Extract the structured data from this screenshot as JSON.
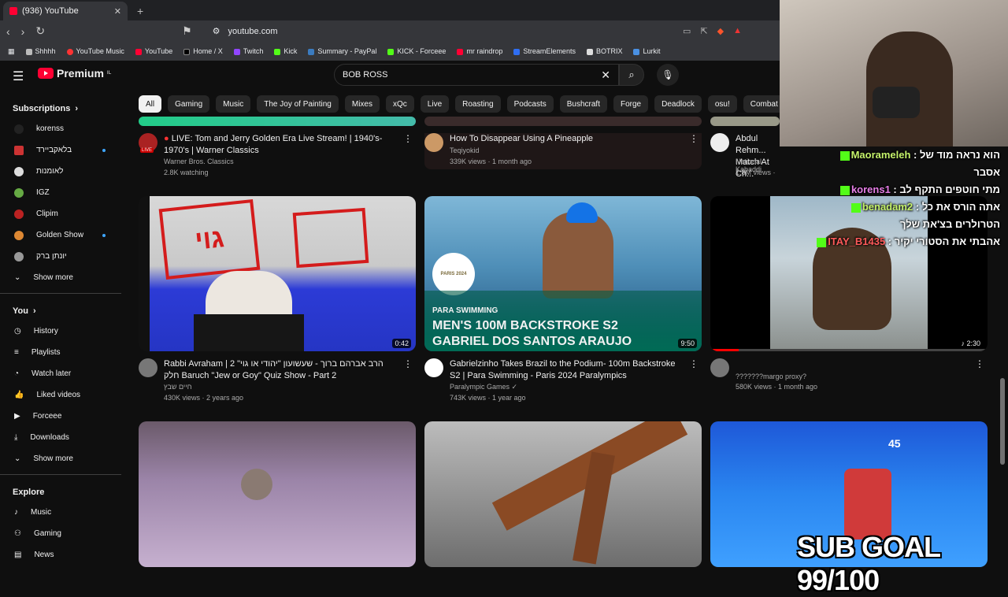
{
  "browser": {
    "tab_title": "(936) YouTube",
    "url": "youtube.com",
    "bookmarks": [
      "Shhhh",
      "YouTube Music",
      "YouTube",
      "Home / X",
      "Twitch",
      "Kick",
      "Summary - PayPal",
      "KICK - Forceee",
      "mr raindrop",
      "StreamElements",
      "BOTRIX",
      "Lurkit"
    ]
  },
  "masthead": {
    "logo": "Premium",
    "logo_sup": "IL",
    "search_value": "BOB ROSS"
  },
  "chips": [
    "All",
    "Gaming",
    "Music",
    "The Joy of Painting",
    "Mixes",
    "xQc",
    "Live",
    "Roasting",
    "Podcasts",
    "Bushcraft",
    "Forge",
    "Deadlock",
    "osu!",
    "Combat sports"
  ],
  "sidebar": {
    "subs_title": "Subscriptions",
    "subs": [
      {
        "name": "korenss",
        "dot": false
      },
      {
        "name": "בלאקביירד",
        "dot": true
      },
      {
        "name": "לאומנות",
        "dot": false
      },
      {
        "name": "IGZ",
        "dot": false
      },
      {
        "name": "Clipim",
        "dot": false
      },
      {
        "name": "Golden Show",
        "dot": true
      },
      {
        "name": "יונתן ברק",
        "dot": false
      }
    ],
    "show_more": "Show more",
    "you_title": "You",
    "you_items": [
      "History",
      "Playlists",
      "Watch later",
      "Liked videos",
      "Forceee",
      "Downloads",
      "Show more"
    ],
    "explore_title": "Explore",
    "explore_items": [
      "Music",
      "Gaming",
      "News"
    ]
  },
  "row1": [
    {
      "title": "LIVE: Tom and Jerry Golden Era Live Stream! | 1940's-1970's | Warner Classics",
      "channel": "Warner Bros. Classics",
      "stats": "2.8K watching",
      "live": "LIVE"
    },
    {
      "title": "How To Disappear Using A Pineapple",
      "channel": "Teqiyokid",
      "stats": "339K views · 1 month ago"
    },
    {
      "title": "Abdul Rehm... Match At Ch...",
      "channel": "National Kabaddi",
      "stats": "1.8M views · 1..."
    }
  ],
  "row2": [
    {
      "title": "Rabbi Avraham | 2 הרב אברהם ברוך - שעשועון \"יהודי או גוי\" חלק Baruch \"Jew or Goy\" Quiz Show - Part 2",
      "channel": "חיים שבץ",
      "stats": "430K views · 2 years ago",
      "duration": "0:42",
      "thumb_text": "גוי"
    },
    {
      "title": "Gabrielzinho Takes Brazil to the Podium- 100m Backstroke S2 | Para Swimming - Paris 2024 Paralympics",
      "channel": "Paralympic Games",
      "stats": "743K views · 1 year ago",
      "duration": "9:50",
      "thumb_line1": "PARA SWIMMING",
      "thumb_line2": "MEN'S 100M BACKSTROKE S2",
      "thumb_line3": "GABRIEL DOS SANTOS ARAUJO",
      "logo_text": "PARIS 2024"
    },
    {
      "title": "???????margo proxy?",
      "channel": "",
      "stats": "580K views · 1 month ago",
      "duration": "2:30"
    }
  ],
  "row3_overlay": "45",
  "chat": [
    {
      "user": "Maorameleh",
      "msg": "הוא נראה מוד של",
      "msg2": "אסבר"
    },
    {
      "user": "korens1",
      "msg": "מתי חוטפים התקף לב"
    },
    {
      "user": "benadam2",
      "msg": "אתה הורס את כל",
      "msg2": "הטרולרים בצ'את שלך"
    },
    {
      "user": "ITAY_B1435",
      "msg": "אהבתי את הסטורי יקיר"
    }
  ],
  "overlay": {
    "goal": "SUB GOAL 99/100"
  }
}
